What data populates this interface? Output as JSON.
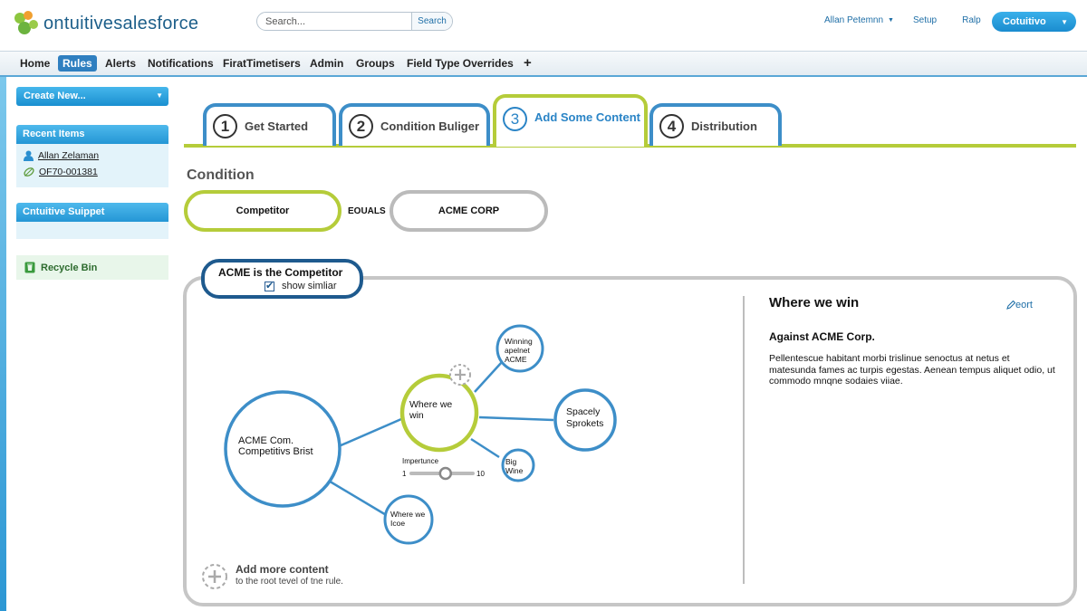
{
  "header": {
    "logo_text": "ontuitivesalesforce",
    "search_placeholder": "Search...",
    "search_button": "Search",
    "user_name": "Allan Petemnn",
    "setup": "Setup",
    "help": "Ralp",
    "app_button": "Cotuitivo"
  },
  "nav": {
    "tabs": [
      "Home",
      "Rules",
      "Alerts",
      "Notifications",
      "FiratTimetisers",
      "Admin",
      "Groups",
      "Field Type Overrides",
      "+"
    ],
    "active": "Rules"
  },
  "sidebar": {
    "create_new": "Create New...",
    "recent_title": "Recent Items",
    "recent_items": [
      "Allan Zelaman",
      "OF70-001381"
    ],
    "support_title": "Cntuitive Suippet",
    "recycle_bin": "Recycle Bin"
  },
  "wizard": {
    "steps": [
      {
        "number": "1",
        "label": "Get Started"
      },
      {
        "number": "2",
        "label": "Condition Buliger"
      },
      {
        "number": "3",
        "label": "Add Some Content"
      },
      {
        "number": "4",
        "label": "Distribution"
      }
    ],
    "active_step": 3
  },
  "condition": {
    "title": "Condition",
    "field": "Competitor",
    "operator": "EOUALS",
    "value": "ACME CORP"
  },
  "rule": {
    "title": "ACME is the Competitor",
    "show_similar": "show simliar",
    "show_similar_checked": true
  },
  "graph": {
    "root": [
      "ACME Com.",
      "Competitivs Brist"
    ],
    "center": [
      "Where we",
      "win"
    ],
    "nodes": {
      "winning": [
        "Winning",
        "apelnet",
        "ACME"
      ],
      "spacely": [
        "Spacely",
        "Sprokets"
      ],
      "bigwine": [
        "Big",
        "Wine"
      ],
      "lose": [
        "Where we",
        "Icoe"
      ]
    },
    "importance_label": "Impertunce",
    "importance_min": "1",
    "importance_max": "10",
    "importance_value": 6
  },
  "add_more": {
    "title": "Add more content",
    "subtitle": "to the root tevel of tne rule."
  },
  "detail": {
    "title": "Where we win",
    "edit": "eort",
    "subtitle": "Against ACME Corp.",
    "body": "Pellentescue habitant morbi trislinue senoctus at netus et matesunda fames ac turpis egestas. Aenean tempus aliquet odio, ut commodo mnqne sodaies viiae."
  },
  "colors": {
    "brand_blue": "#1f6fa7",
    "accent_green": "#b5cc3a",
    "node_blue": "#3d8ec8",
    "dark_navy": "#1e5a8e"
  }
}
